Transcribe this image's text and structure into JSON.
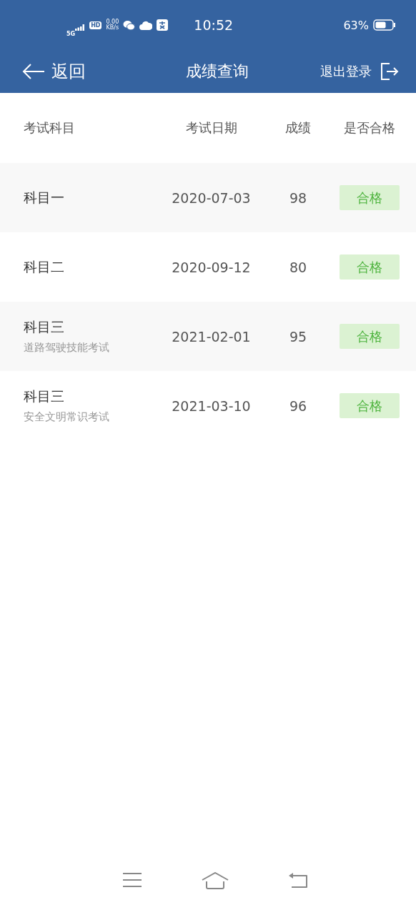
{
  "status_bar": {
    "network": "5G",
    "hd": "HD",
    "speed": "0.00",
    "speed_unit": "KB/s",
    "time": "10:52",
    "battery": "63%"
  },
  "nav": {
    "back": "返回",
    "title": "成绩查询",
    "logout": "退出登录"
  },
  "table": {
    "columns": [
      "考试科目",
      "考试日期",
      "成绩",
      "是否合格"
    ],
    "rows": [
      {
        "subject": "科目一",
        "date": "2020-07-03",
        "score": "98",
        "result": "合格",
        "passed": true
      },
      {
        "subject": "科目二",
        "date": "2020-09-12",
        "score": "80",
        "result": "合格",
        "passed": true
      },
      {
        "subject": "科目三",
        "subtitle": "道路驾驶技能考试",
        "date": "2021-02-01",
        "score": "95",
        "result": "合格",
        "passed": true
      },
      {
        "subject": "科目三",
        "subtitle": "安全文明常识考试",
        "date": "2021-03-10",
        "score": "96",
        "result": "合格",
        "passed": true
      }
    ]
  }
}
